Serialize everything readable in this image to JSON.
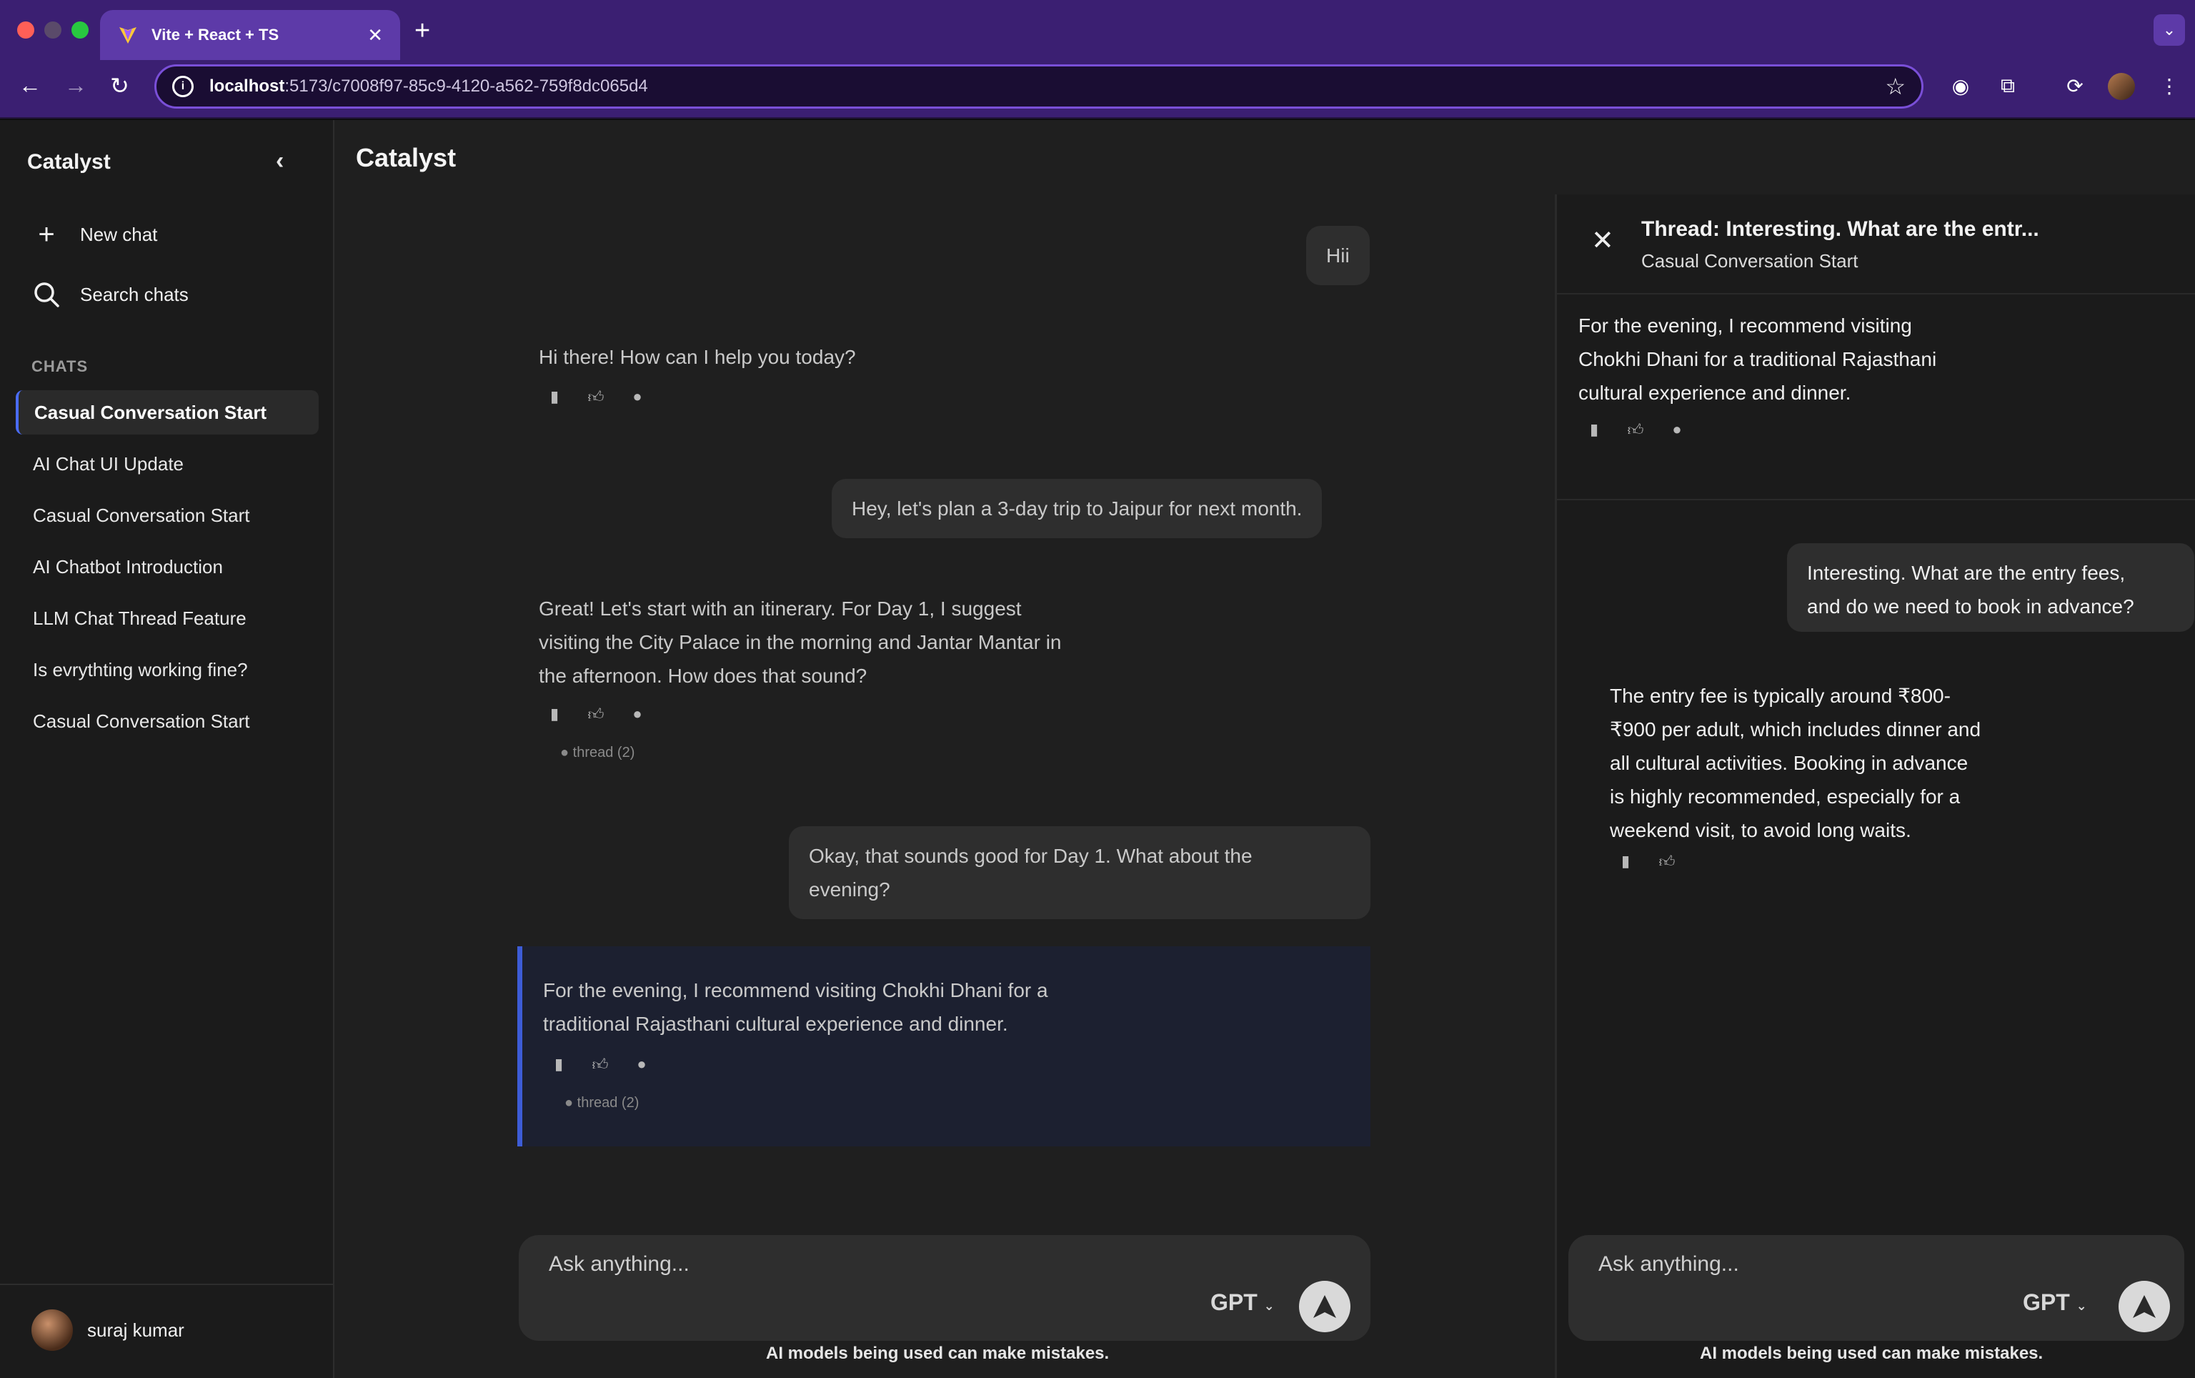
{
  "browser": {
    "tab_title": "Vite + React + TS",
    "url_host": "localhost",
    "url_path": ":5173/c7008f97-85c9-4120-a562-759f8dc065d4"
  },
  "sidebar": {
    "title": "Catalyst",
    "new_chat": "New chat",
    "search_chats": "Search chats",
    "section_label": "CHATS",
    "items": [
      {
        "label": "Casual Conversation Start",
        "active": true
      },
      {
        "label": "AI Chat UI Update"
      },
      {
        "label": "Casual Conversation Start"
      },
      {
        "label": "AI Chatbot Introduction"
      },
      {
        "label": "LLM Chat Thread Feature"
      },
      {
        "label": "Is evrythting working fine?"
      },
      {
        "label": "Casual Conversation Start"
      }
    ],
    "user_name": "suraj kumar"
  },
  "main": {
    "title": "Catalyst",
    "messages": {
      "m1_user": "Hii",
      "m2_assistant": "Hi there! How can I help you today?",
      "m3_user": "Hey, let's plan a 3-day trip to Jaipur for next month.",
      "m4_assistant_l1": "Great! Let's start with an itinerary. For Day 1, I suggest",
      "m4_assistant_l2": "visiting the City Palace in the morning and Jantar Mantar in",
      "m4_assistant_l3": "the afternoon. How does that sound?",
      "m4_thread": "thread (2)",
      "m5_user_l1": "Okay, that sounds good for Day 1. What about the",
      "m5_user_l2": "evening?",
      "m6_assistant_l1": "For the evening, I recommend visiting Chokhi Dhani for a",
      "m6_assistant_l2": "traditional Rajasthani cultural experience and dinner.",
      "m6_thread": "thread (2)"
    },
    "composer": {
      "placeholder": "Ask anything...",
      "model": "GPT",
      "disclaimer": "AI models being used can make mistakes."
    }
  },
  "thread": {
    "title": "Thread: Interesting. What are the entr...",
    "subtitle": "Casual Conversation Start",
    "parent_l1": "For the evening, I recommend visiting",
    "parent_l2": "Chokhi Dhani for a traditional Rajasthani",
    "parent_l3": "cultural experience and dinner.",
    "user_l1": "Interesting. What are the entry fees,",
    "user_l2": "and do we need to book in advance?",
    "reply_l1": "The entry fee is typically around ₹800-",
    "reply_l2": "₹900 per adult, which includes dinner and",
    "reply_l3": "all cultural activities. Booking in advance",
    "reply_l4": "is highly recommended, especially for a",
    "reply_l5": "weekend visit, to avoid long waits.",
    "composer": {
      "placeholder": "Ask anything...",
      "model": "GPT",
      "disclaimer": "AI models being used can make mistakes."
    }
  },
  "colors": {
    "chrome": "#3b1f72",
    "accent": "#3d5cd6",
    "app_bg": "#1f1f1f"
  }
}
